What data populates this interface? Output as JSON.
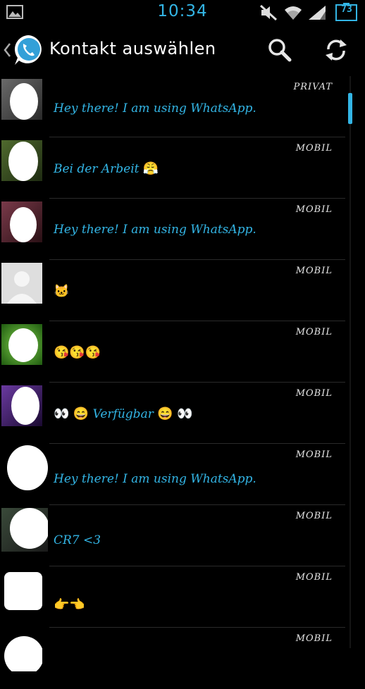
{
  "status_bar": {
    "time": "10:34",
    "battery_level": "73",
    "icons": [
      "gallery-icon",
      "mute-icon",
      "wifi-icon",
      "signal-icon",
      "battery-icon"
    ]
  },
  "action_bar": {
    "title": "Kontakt auswählen",
    "icons": [
      "back-chevron-icon",
      "whatsapp-logo-icon",
      "search-icon",
      "refresh-icon"
    ]
  },
  "colors": {
    "accent": "#33b5e5",
    "background": "#000000",
    "text": "#ffffff"
  },
  "contacts": [
    {
      "type": "PRIVAT",
      "status": "Hey there! I am using WhatsApp.",
      "emoji": []
    },
    {
      "type": "MOBIL",
      "status": "Bei der Arbeit",
      "emoji": [
        "😤"
      ]
    },
    {
      "type": "MOBIL",
      "status": "Hey there! I am using WhatsApp.",
      "emoji": []
    },
    {
      "type": "MOBIL",
      "status": "",
      "emoji": [
        "🐱"
      ]
    },
    {
      "type": "MOBIL",
      "status": "",
      "emoji": [
        "😘",
        "😘",
        "😘"
      ]
    },
    {
      "type": "MOBIL",
      "status": "Verfügbar",
      "emoji": [
        "👀",
        "😄",
        "😄",
        "👀"
      ]
    },
    {
      "type": "MOBIL",
      "status": "Hey there! I am using WhatsApp.",
      "emoji": []
    },
    {
      "type": "MOBIL",
      "status": "CR7 <3",
      "emoji": []
    },
    {
      "type": "MOBIL",
      "status": "",
      "emoji": [
        "👉",
        "👈"
      ]
    },
    {
      "type": "MOBIL",
      "status": "",
      "emoji": []
    }
  ]
}
